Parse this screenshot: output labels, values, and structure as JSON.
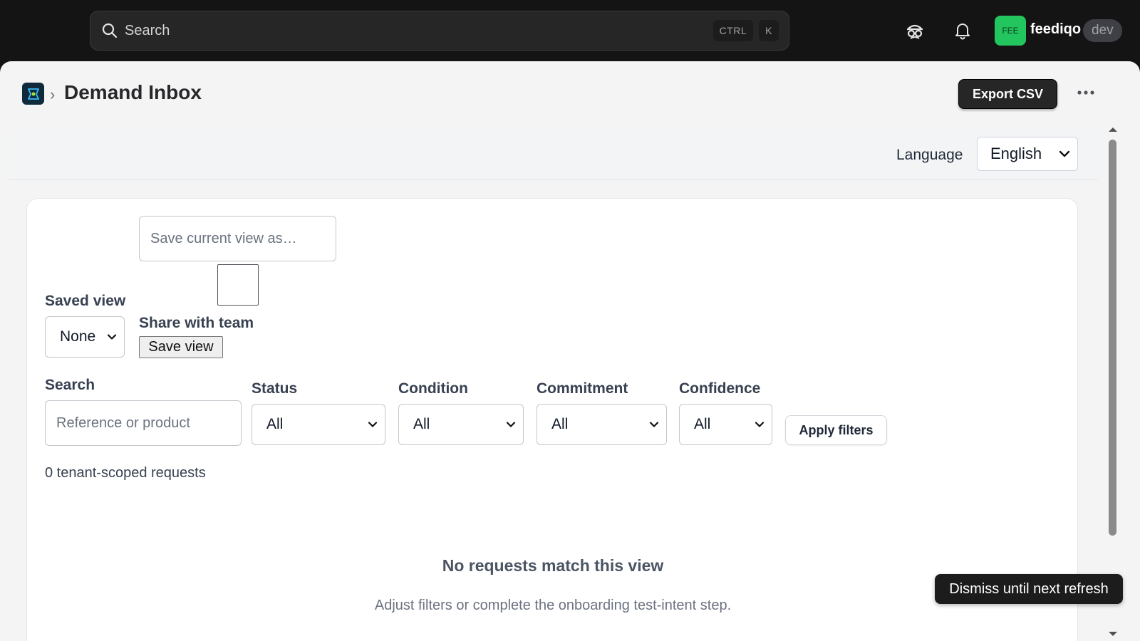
{
  "topbar": {
    "search_placeholder": "Search",
    "shortcut_keys": [
      "CTRL",
      "K"
    ],
    "avatar_initials": "FEE",
    "org_name": "feediqo",
    "env_badge": "dev",
    "icons": [
      "search-icon",
      "incognito-icon",
      "bell-icon"
    ]
  },
  "header": {
    "breadcrumb_separator": "›",
    "title": "Demand Inbox",
    "export_label": "Export CSV",
    "more_icon": "ellipsis-icon"
  },
  "language": {
    "label": "Language",
    "selected": "English"
  },
  "saved_views": {
    "name_placeholder": "Save current view as…",
    "saved_view_label": "Saved view",
    "saved_view_selected": "None",
    "share_label": "Share with team",
    "share_checked": false,
    "save_button": "Save view"
  },
  "filters": {
    "search_label": "Search",
    "search_placeholder": "Reference or product",
    "status_label": "Status",
    "status_selected": "All",
    "condition_label": "Condition",
    "condition_selected": "All",
    "commitment_label": "Commitment",
    "commitment_selected": "All",
    "confidence_label": "Confidence",
    "confidence_selected": "All",
    "apply_button": "Apply filters"
  },
  "results": {
    "count_text": "0 tenant-scoped requests",
    "empty_title": "No requests match this view",
    "empty_subtitle": "Adjust filters or complete the onboarding test-intent step."
  },
  "toast": {
    "text": "Dismiss until next refresh"
  },
  "colors": {
    "topbar_bg": "#141414",
    "avatar_bg": "#22c55e",
    "primary_button": "#262626",
    "page_bg": "#f4f4f5"
  }
}
